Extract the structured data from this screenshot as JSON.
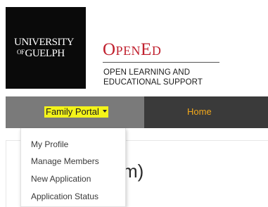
{
  "logo": {
    "line1": "UNIVERSITY",
    "line2": "GUELPH",
    "prefix": "OF"
  },
  "brand": {
    "name": "OpenEd",
    "tagline_line1": "OPEN LEARNING AND",
    "tagline_line2": "EDUCATIONAL SUPPORT",
    "color": "#c0202e"
  },
  "nav": {
    "dropdown_label": "Family Portal",
    "home_label": "Home",
    "home_color": "#f2a81c",
    "highlight_color": "#f4f41a"
  },
  "dropdown_menu": {
    "items": [
      {
        "label": "My Profile"
      },
      {
        "label": "Manage Members"
      },
      {
        "label": "New Application"
      },
      {
        "label": "Application Status"
      }
    ]
  },
  "main": {
    "heading_visible_fragment": "m)"
  }
}
